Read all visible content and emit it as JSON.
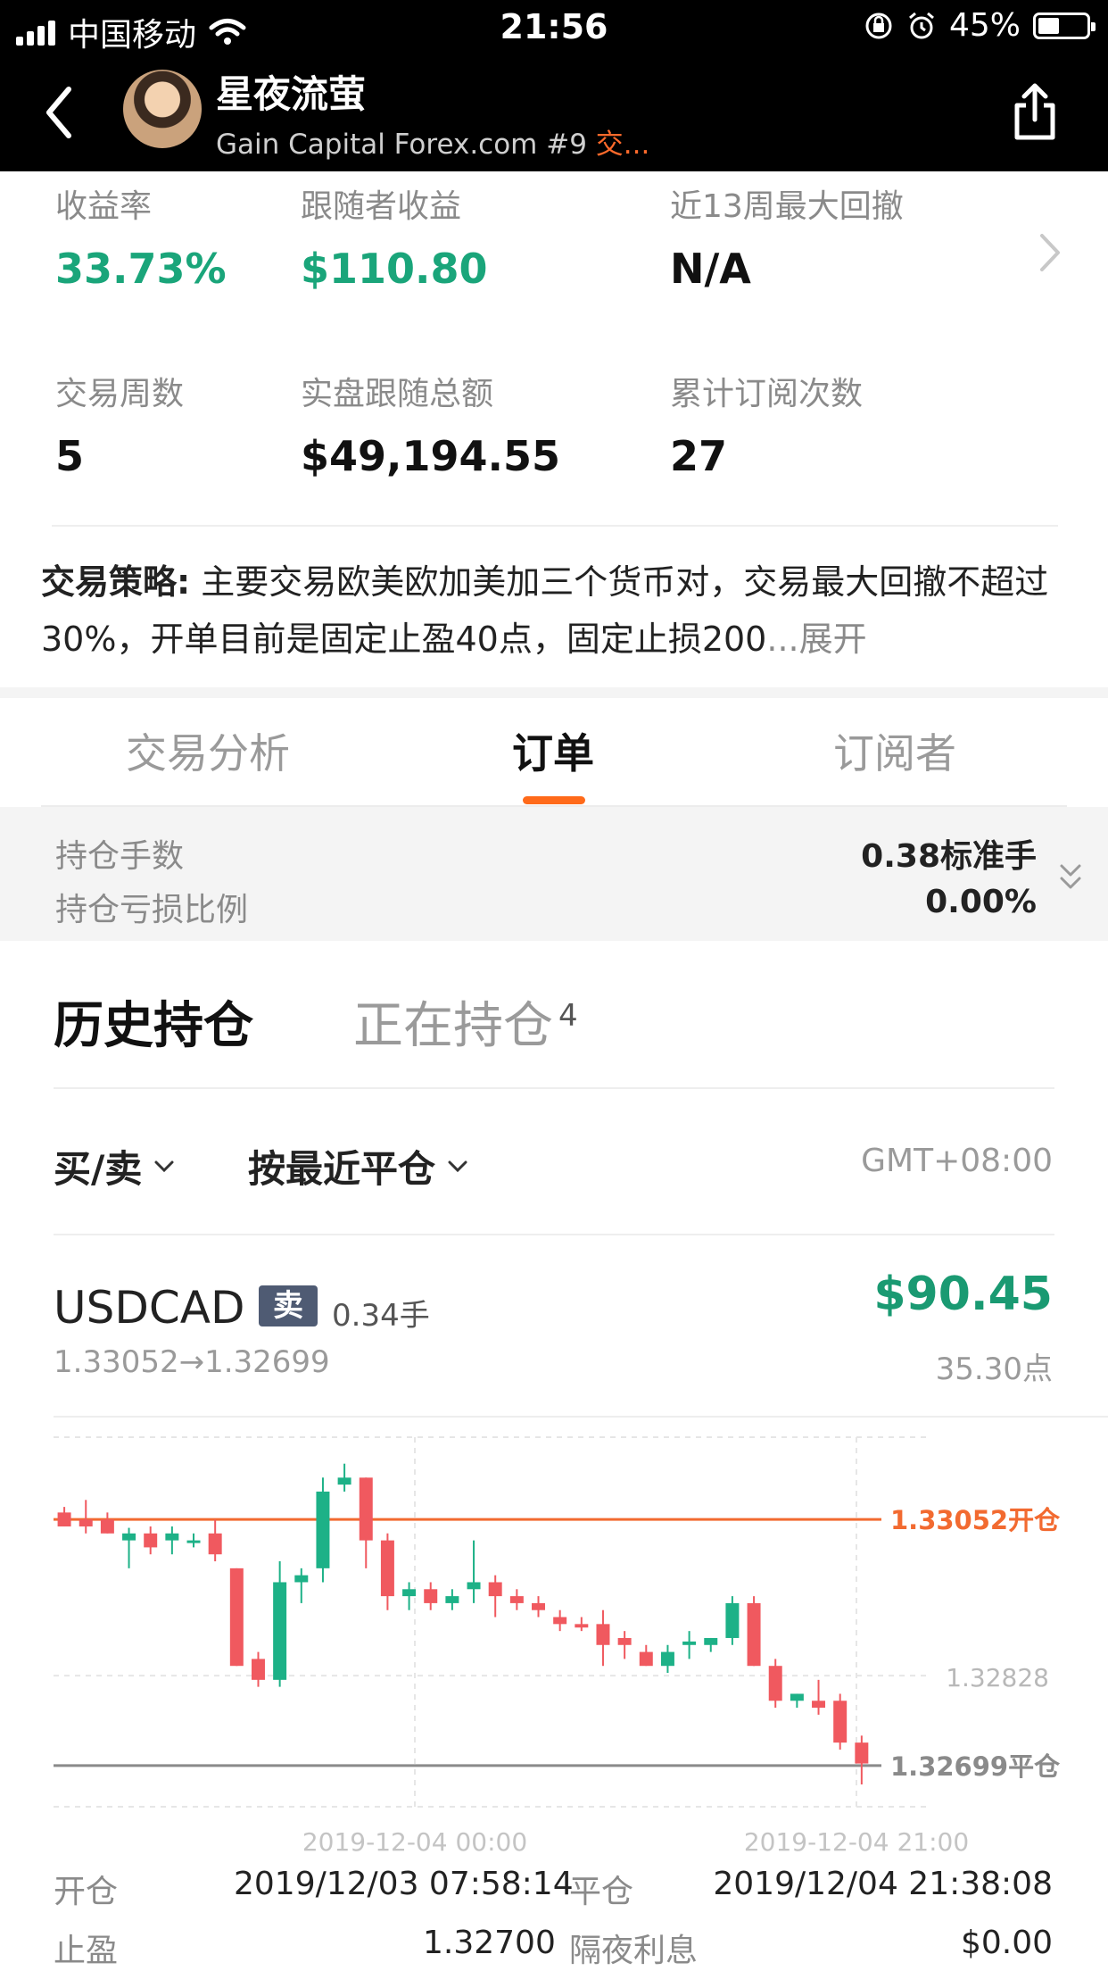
{
  "status_bar": {
    "carrier": "中国移动",
    "time": "21:56",
    "battery": "45%"
  },
  "header": {
    "name": "星夜流萤",
    "subtitle": "Gain Capital Forex.com #9",
    "subtitle_tag": "交...",
    "icons": {
      "back": "chevron-left-icon",
      "share": "share-icon"
    }
  },
  "stats": {
    "return_label": "收益率",
    "return_value": "33.73%",
    "follower_profit_label": "跟随者收益",
    "follower_profit_value": "$110.80",
    "drawdown_label": "近13周最大回撤",
    "drawdown_value": "N/A",
    "weeks_label": "交易周数",
    "weeks_value": "5",
    "follow_total_label": "实盘跟随总额",
    "follow_total_value": "$49,194.55",
    "subs_label": "累计订阅次数",
    "subs_value": "27"
  },
  "strategy": {
    "label": "交易策略:",
    "text": " 主要交易欧美欧加美加三个货币对，交易最大回撤不超过30%，开单目前是固定止盈40点，固定止损200",
    "ellipsis": "...",
    "more": "展开"
  },
  "tabs": [
    {
      "label": "交易分析"
    },
    {
      "label": "订单"
    },
    {
      "label": "订阅者"
    }
  ],
  "summary": {
    "lots_label": "持仓手数",
    "lots_value": "0.38标准手",
    "loss_label": "持仓亏损比例",
    "loss_value": "0.00%"
  },
  "positions": {
    "history_tab": "历史持仓",
    "open_tab": "正在持仓",
    "open_count": "4",
    "filter_side": "买/卖",
    "filter_sort": "按最近平仓",
    "timezone": "GMT+08:00"
  },
  "trade": {
    "symbol": "USDCAD",
    "side": "卖",
    "lots": "0.34手",
    "pnl": "$90.45",
    "prices": "1.33052→1.32699",
    "points": "35.30点",
    "open_label": "开仓",
    "open_time": "2019/12/03 07:58:14",
    "close_label": "平仓",
    "close_time": "2019/12/04 21:38:08",
    "tp_label": "止盈",
    "tp_value": "1.32700",
    "swap_label": "隔夜利息",
    "swap_value": "$0.00"
  },
  "colors": {
    "up": "#1db187",
    "down": "#f0595f",
    "open_line": "#f26a30",
    "close_line": "#8a8a8a"
  },
  "chart_data": {
    "type": "candlestick",
    "x_ticks": [
      "2019-12-04 00:00",
      "2019-12-04 21:00"
    ],
    "y_tick_label": "1.32828",
    "y_tick_value": 1.32828,
    "open_line": {
      "value": 1.33052,
      "label": "1.33052开仓"
    },
    "close_line": {
      "value": 1.32699,
      "label": "1.32699平仓"
    },
    "ylim": [
      1.3264,
      1.3317
    ],
    "candles": [
      {
        "o": 1.33062,
        "h": 1.3307,
        "l": 1.33042,
        "c": 1.33042
      },
      {
        "o": 1.33052,
        "h": 1.3308,
        "l": 1.33032,
        "c": 1.33042
      },
      {
        "o": 1.33052,
        "h": 1.33062,
        "l": 1.33032,
        "c": 1.33032
      },
      {
        "o": 1.33022,
        "h": 1.3304,
        "l": 1.32982,
        "c": 1.33032
      },
      {
        "o": 1.33032,
        "h": 1.33042,
        "l": 1.33002,
        "c": 1.33012
      },
      {
        "o": 1.33022,
        "h": 1.33042,
        "l": 1.33002,
        "c": 1.33032
      },
      {
        "o": 1.33022,
        "h": 1.33032,
        "l": 1.33012,
        "c": 1.33022
      },
      {
        "o": 1.33032,
        "h": 1.33052,
        "l": 1.32992,
        "c": 1.33002
      },
      {
        "o": 1.32982,
        "h": 1.32982,
        "l": 1.32842,
        "c": 1.32842
      },
      {
        "o": 1.32852,
        "h": 1.32862,
        "l": 1.32812,
        "c": 1.32822
      },
      {
        "o": 1.32822,
        "h": 1.32992,
        "l": 1.32812,
        "c": 1.32962
      },
      {
        "o": 1.32962,
        "h": 1.32982,
        "l": 1.32932,
        "c": 1.32972
      },
      {
        "o": 1.32982,
        "h": 1.33112,
        "l": 1.32962,
        "c": 1.33092
      },
      {
        "o": 1.33102,
        "h": 1.33132,
        "l": 1.33092,
        "c": 1.33112
      },
      {
        "o": 1.33112,
        "h": 1.33112,
        "l": 1.32982,
        "c": 1.33022
      },
      {
        "o": 1.33022,
        "h": 1.33032,
        "l": 1.32922,
        "c": 1.32942
      },
      {
        "o": 1.32942,
        "h": 1.32962,
        "l": 1.32922,
        "c": 1.32952
      },
      {
        "o": 1.32952,
        "h": 1.32962,
        "l": 1.32922,
        "c": 1.32932
      },
      {
        "o": 1.32932,
        "h": 1.32952,
        "l": 1.32922,
        "c": 1.32942
      },
      {
        "o": 1.32952,
        "h": 1.33022,
        "l": 1.32932,
        "c": 1.32962
      },
      {
        "o": 1.32962,
        "h": 1.32972,
        "l": 1.32912,
        "c": 1.32942
      },
      {
        "o": 1.32942,
        "h": 1.32952,
        "l": 1.32922,
        "c": 1.32932
      },
      {
        "o": 1.32932,
        "h": 1.32942,
        "l": 1.32912,
        "c": 1.32922
      },
      {
        "o": 1.32912,
        "h": 1.32922,
        "l": 1.32892,
        "c": 1.32902
      },
      {
        "o": 1.32902,
        "h": 1.32912,
        "l": 1.32892,
        "c": 1.32897
      },
      {
        "o": 1.32902,
        "h": 1.32922,
        "l": 1.32842,
        "c": 1.32872
      },
      {
        "o": 1.32882,
        "h": 1.32892,
        "l": 1.32852,
        "c": 1.32872
      },
      {
        "o": 1.32862,
        "h": 1.32872,
        "l": 1.32842,
        "c": 1.32842
      },
      {
        "o": 1.32842,
        "h": 1.32872,
        "l": 1.32832,
        "c": 1.32862
      },
      {
        "o": 1.32872,
        "h": 1.32892,
        "l": 1.32852,
        "c": 1.32877
      },
      {
        "o": 1.32872,
        "h": 1.32882,
        "l": 1.32862,
        "c": 1.32882
      },
      {
        "o": 1.32882,
        "h": 1.32942,
        "l": 1.32872,
        "c": 1.32932
      },
      {
        "o": 1.32932,
        "h": 1.32942,
        "l": 1.32842,
        "c": 1.32842
      },
      {
        "o": 1.32842,
        "h": 1.32852,
        "l": 1.32782,
        "c": 1.32792
      },
      {
        "o": 1.32792,
        "h": 1.32802,
        "l": 1.32782,
        "c": 1.32802
      },
      {
        "o": 1.32792,
        "h": 1.32822,
        "l": 1.32772,
        "c": 1.32782
      },
      {
        "o": 1.32792,
        "h": 1.32802,
        "l": 1.32722,
        "c": 1.32732
      },
      {
        "o": 1.32732,
        "h": 1.32742,
        "l": 1.32672,
        "c": 1.32702
      }
    ]
  }
}
